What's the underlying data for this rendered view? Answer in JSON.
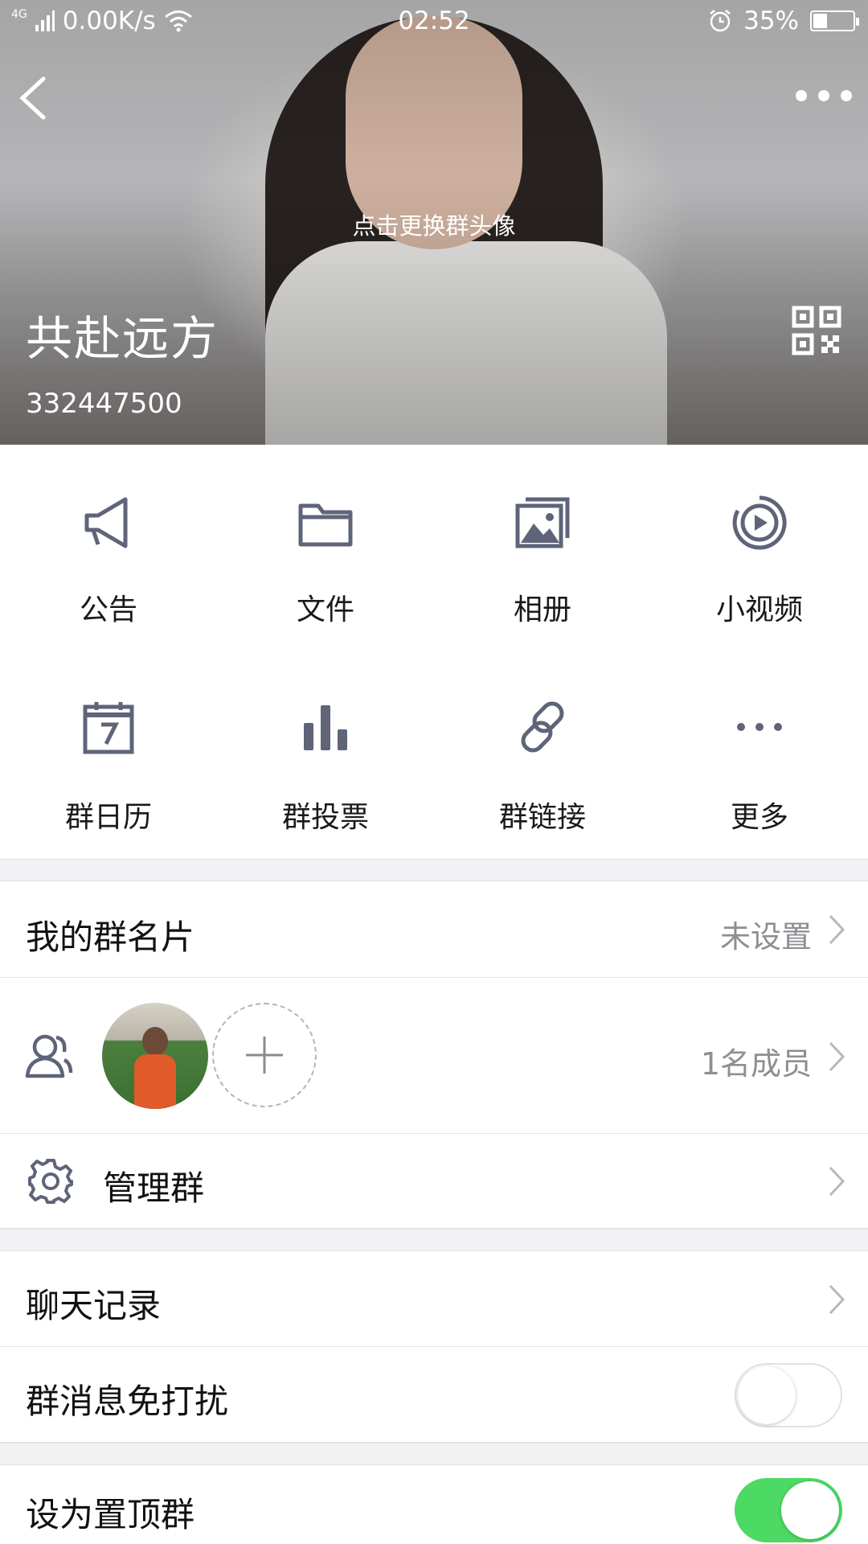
{
  "status_bar": {
    "network": "4G",
    "speed": "0.00K/s",
    "time": "02:52",
    "battery": "35%",
    "battery_level": 0.35
  },
  "header": {
    "avatar_hint": "点击更换群头像",
    "group_name": "共赴远方",
    "group_id": "332447500"
  },
  "features": [
    {
      "label": "公告",
      "icon": "megaphone-icon"
    },
    {
      "label": "文件",
      "icon": "folder-icon"
    },
    {
      "label": "相册",
      "icon": "photo-album-icon"
    },
    {
      "label": "小视频",
      "icon": "video-play-icon"
    },
    {
      "label": "群日历",
      "icon": "calendar-icon"
    },
    {
      "label": "群投票",
      "icon": "bar-chart-icon"
    },
    {
      "label": "群链接",
      "icon": "link-icon"
    },
    {
      "label": "更多",
      "icon": "more-dots-icon"
    }
  ],
  "settings": {
    "card": {
      "title": "我的群名片",
      "value": "未设置"
    },
    "members": {
      "value": "1名成员"
    },
    "manage": {
      "title": "管理群"
    },
    "history": {
      "title": "聊天记录"
    },
    "mute": {
      "title": "群消息免打扰",
      "enabled": false
    },
    "pin": {
      "title": "设为置顶群",
      "enabled": true
    }
  },
  "colors": {
    "icon": "#5f6479",
    "toggle_on": "#4cd964",
    "secondary_text": "#8e8e93"
  }
}
